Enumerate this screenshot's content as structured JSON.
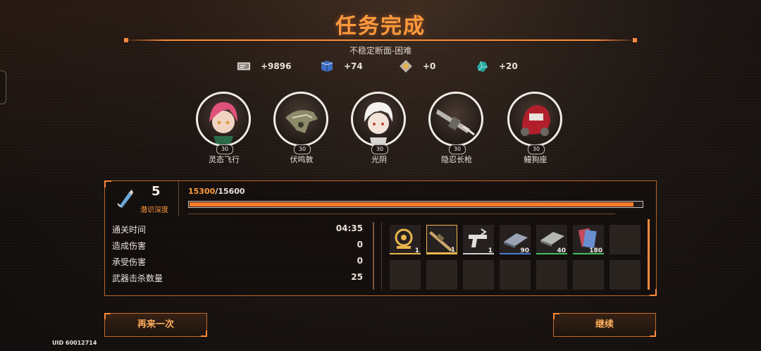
{
  "title": "任务完成",
  "subtitle": "不稳定断面-困难",
  "rewards": [
    {
      "icon": "ticket-icon",
      "value": "+9896"
    },
    {
      "icon": "book-icon",
      "value": "+74"
    },
    {
      "icon": "diamond-chip-icon",
      "value": "+0"
    },
    {
      "icon": "crystal-icon",
      "value": "+20"
    }
  ],
  "team": [
    {
      "name": "灵态飞行",
      "level": "30",
      "icon": "pink-hair-character-portrait"
    },
    {
      "name": "伏鸣敦",
      "level": "30",
      "icon": "drone-creature-portrait"
    },
    {
      "name": "光阴",
      "level": "30",
      "icon": "white-hair-character-portrait"
    },
    {
      "name": "隐忍长枪",
      "level": "30",
      "icon": "rifle-portrait"
    },
    {
      "name": "鳗狗座",
      "level": "30",
      "icon": "red-mech-portrait"
    }
  ],
  "depth": {
    "value": "5",
    "label": "潜识深度"
  },
  "xp": {
    "current": "15300",
    "separator": "/",
    "max": "15600",
    "fraction": 0.981
  },
  "stats": [
    {
      "label": "通关时间",
      "value": "04:35"
    },
    {
      "label": "造成伤害",
      "value": "0"
    },
    {
      "label": "承受伤害",
      "value": "0"
    },
    {
      "label": "武器击杀数量",
      "value": "25"
    }
  ],
  "loot": [
    {
      "icon": "compass-badge-icon",
      "count": "1",
      "rarity_color": "#e9b44c"
    },
    {
      "icon": "sniper-rifle-icon",
      "count": "1",
      "rarity_color": "#e9b44c"
    },
    {
      "icon": "pistol-icon",
      "count": "1",
      "rarity_color": "#cfcfcf"
    },
    {
      "icon": "plate-blue-icon",
      "count": "90",
      "rarity_color": "#4a7bd8"
    },
    {
      "icon": "plate-green-icon",
      "count": "40",
      "rarity_color": "#3fbf5a"
    },
    {
      "icon": "card-bundle-icon",
      "count": "180",
      "rarity_color": "#3fbf5a"
    }
  ],
  "buttons": {
    "retry": "再来一次",
    "continue": "继续"
  },
  "uid": "UID 60012714",
  "colors": {
    "accent": "#ff8a3c",
    "xp_fill": "#ff7a2a"
  }
}
